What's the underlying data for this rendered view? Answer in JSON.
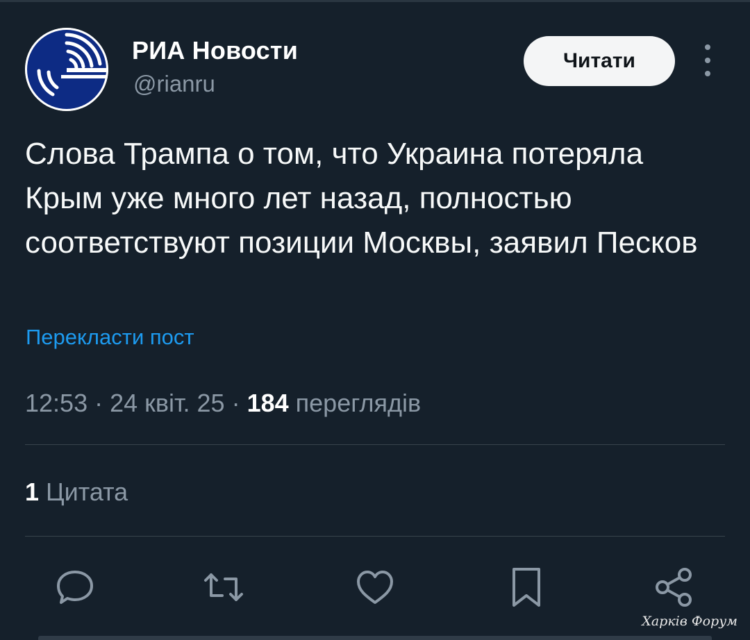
{
  "author": {
    "display_name": "РИА Новости",
    "handle": "@rianru",
    "brand_color": "#0d2b84"
  },
  "follow_button": {
    "label": "Читати"
  },
  "tweet": {
    "text": "Слова Трампа о том, что Украина потеряла Крым уже много лет назад, полностью соответствуют позиции Москвы, заявил Песков",
    "translate_label": "Перекласти пост"
  },
  "meta": {
    "time": "12:53",
    "separator": " · ",
    "date": "24 квіт. 25",
    "views_count": "184",
    "views_label": "переглядів"
  },
  "stats": {
    "quote_count": "1",
    "quote_label": "Цитата"
  },
  "actions": {
    "reply_icon": "reply-icon",
    "retweet_icon": "retweet-icon",
    "like_icon": "heart-icon",
    "bookmark_icon": "bookmark-icon",
    "share_icon": "share-icon"
  },
  "watermark": {
    "text": "Харків Форум"
  },
  "colors": {
    "background": "#15202b",
    "accent": "#1d9bf0",
    "muted": "#8b98a5",
    "divider": "#38444d"
  }
}
